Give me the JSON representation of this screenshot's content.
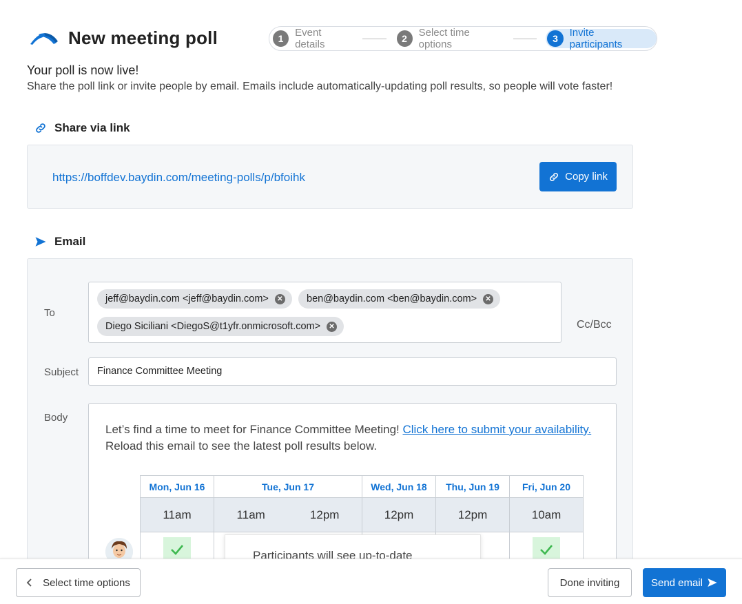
{
  "header": {
    "title": "New meeting poll",
    "steps": [
      {
        "num": "1",
        "label": "Event details"
      },
      {
        "num": "2",
        "label": "Select time options"
      },
      {
        "num": "3",
        "label": "Invite participants"
      }
    ],
    "active_step": 3
  },
  "intro": {
    "heading": "Your poll is now live!",
    "description": "Share the poll link or invite people by email. Emails include automatically-updating poll results, so people will vote faster!"
  },
  "share": {
    "heading": "Share via link",
    "url": "https://boffdev.baydin.com/meeting-polls/p/bfoihk",
    "copy_label": "Copy link"
  },
  "email": {
    "heading": "Email",
    "to_label": "To",
    "recipients": [
      "jeff@baydin.com <jeff@baydin.com>",
      "ben@baydin.com <ben@baydin.com>",
      "Diego Siciliani <DiegoS@t1yfr.onmicrosoft.com>"
    ],
    "cc_bcc": "Cc/Bcc",
    "subject_label": "Subject",
    "subject": "Finance Committee Meeting",
    "body_label": "Body",
    "body_text_1": "Let’s find a time to meet for Finance Committee Meeting! ",
    "body_link": "Click here to submit your availability.",
    "body_text_2": "Reload this email to see the latest poll results below.",
    "poll": {
      "days": [
        "Mon, Jun 16",
        "Tue, Jun 17",
        "Wed, Jun 18",
        "Thu, Jun 19",
        "Fri, Jun 20"
      ],
      "times": [
        "11am",
        "11am",
        "12pm",
        "12pm",
        "12pm",
        "10am"
      ],
      "popup_text": "Participants will see up-to-date"
    }
  },
  "footer": {
    "back_label": "Select time options",
    "done_label": "Done inviting",
    "send_label": "Send email"
  },
  "colors": {
    "accent": "#1273d4",
    "panel": "#f5f7f9",
    "chip": "#e1e3e6",
    "check_bg": "#d8f5dc",
    "check": "#3db84f"
  }
}
